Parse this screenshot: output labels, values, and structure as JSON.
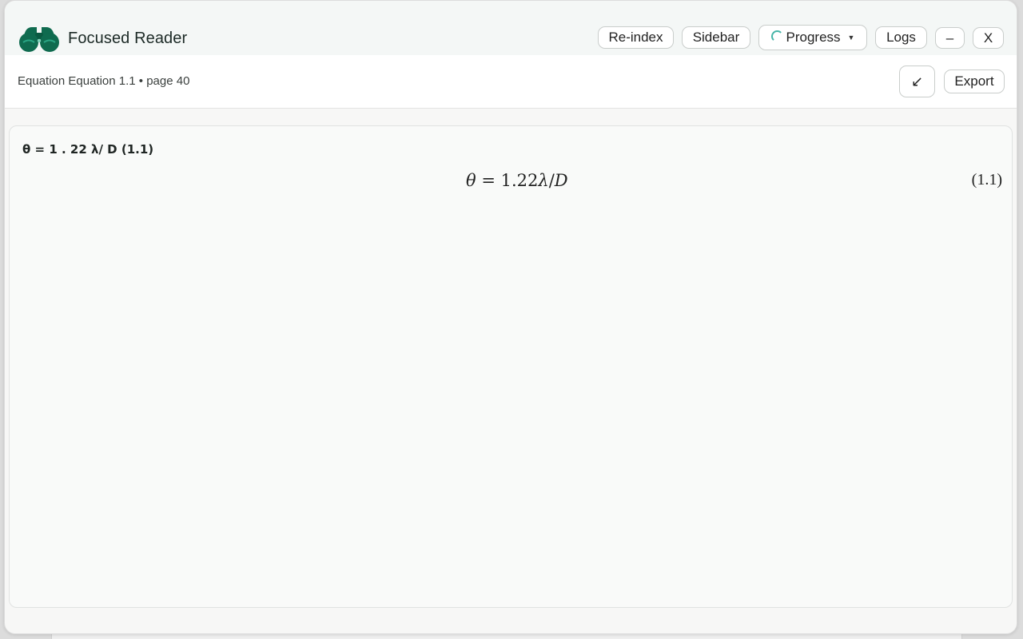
{
  "app": {
    "title": "Focused Reader",
    "accent_color": "#0f6b4f",
    "logo_icon": "binoculars-icon"
  },
  "titlebar": {
    "buttons": {
      "reindex": "Re-index",
      "sidebar": "Sidebar",
      "progress": "Progress",
      "logs": "Logs",
      "minimize": "–",
      "close": "X"
    }
  },
  "subbar": {
    "breadcrumb": "Equation Equation 1.1 • page 40",
    "collapse_icon": "↙",
    "export": "Export"
  },
  "equation": {
    "plain_text": "θ = 1 . 22 λ/ D (1.1)",
    "theta": "θ",
    "equals": "=",
    "coefficient": "1.22",
    "lambda": "λ",
    "slash": "/",
    "denominator": "D",
    "number": "(1.1)"
  }
}
